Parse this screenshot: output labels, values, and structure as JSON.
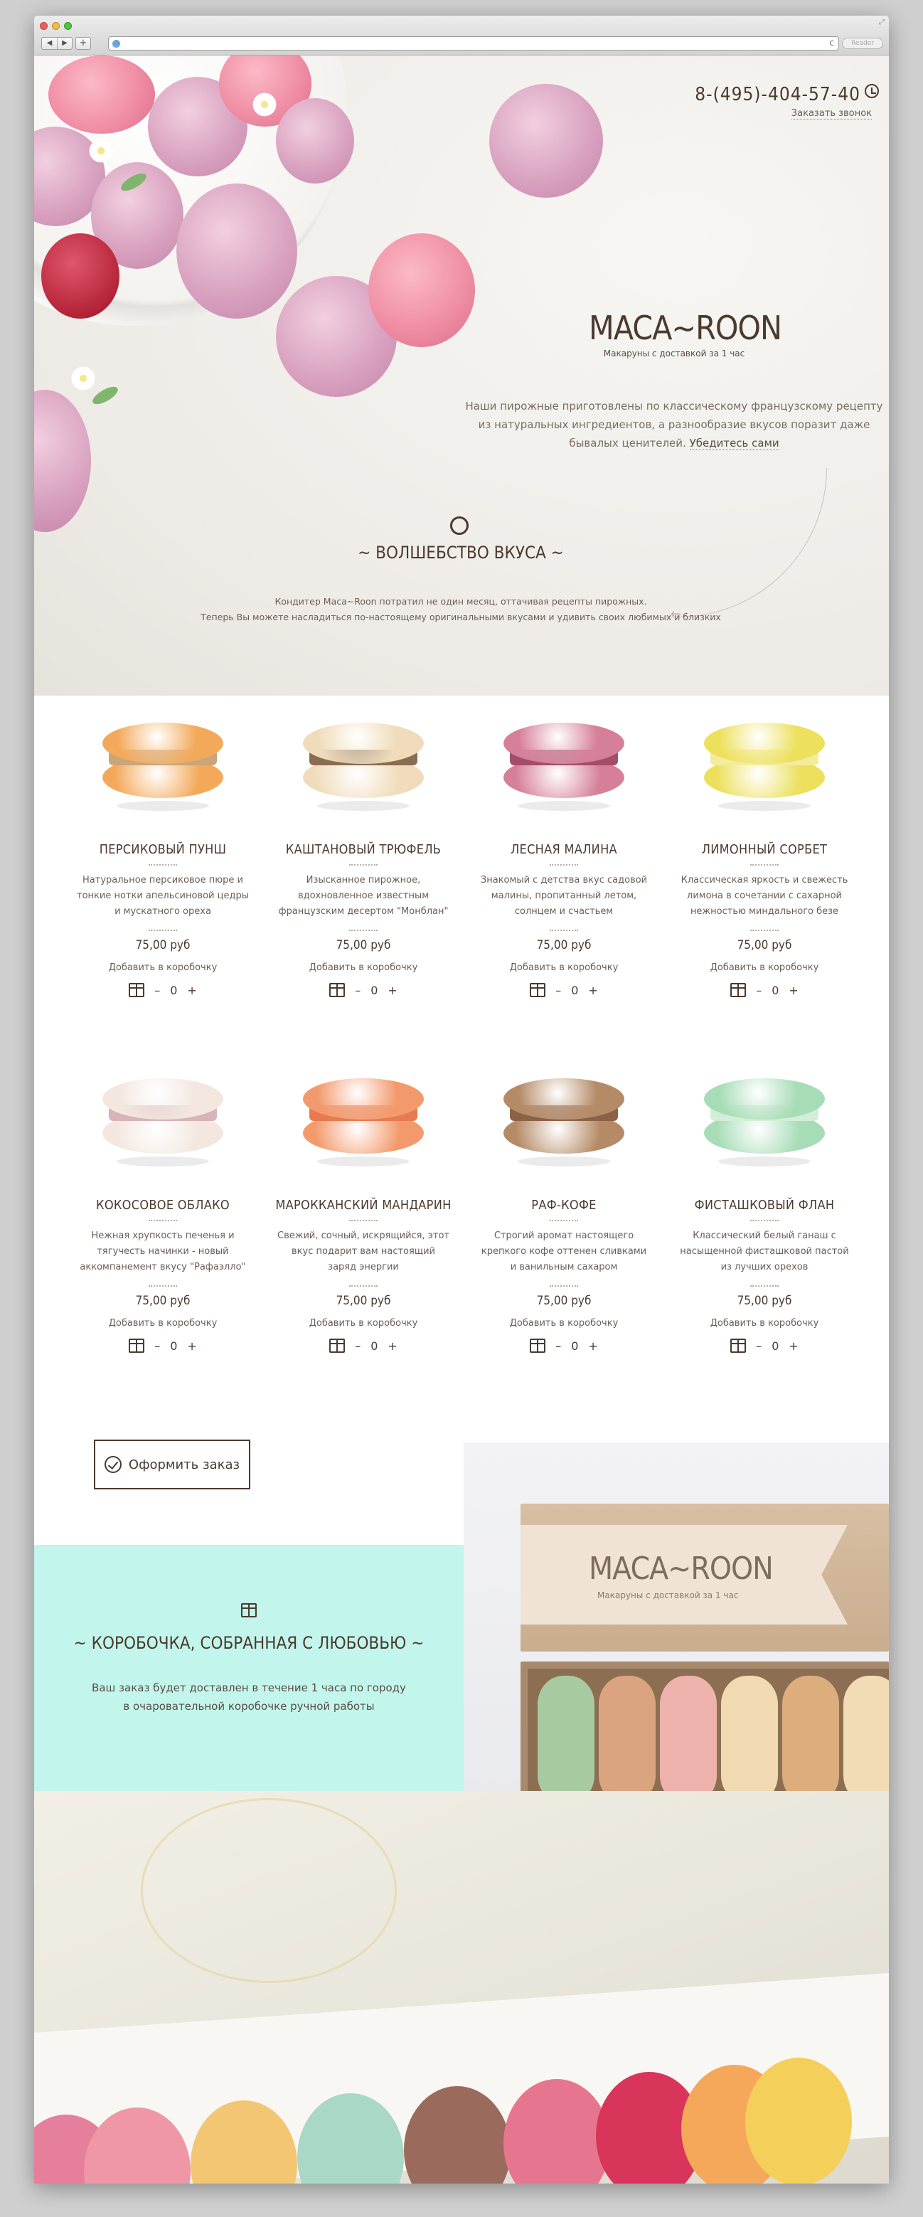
{
  "browser": {
    "back": "◀",
    "forward": "▶",
    "new_tab": "+",
    "reader": "Reader",
    "reload": "c"
  },
  "header": {
    "phone": "8-(495)-404-57-40",
    "callback": "Заказать звонок"
  },
  "brand": {
    "logo": "MACA~ROON",
    "tagline": "Макаруны с доставкой за 1 час"
  },
  "intro": {
    "text": "Наши пирожные приготовлены по классическому французскому рецепту из натуральных ингредиентов, а разнообразие вкусов поразит даже бывалых ценителей.",
    "link": "Убедитесь сами"
  },
  "section": {
    "title": "~ ВОЛШЕБСТВО ВКУСА ~",
    "line1": "Кондитер Maca~Roon потратил не один месяц, оттачивая рецепты пирожных.",
    "line2": "Теперь Вы можете насладиться по-настоящему оригинальными вкусами и удивить своих любимых и близких"
  },
  "products": [
    {
      "name": "ПЕРСИКОВЫЙ ПУНШ",
      "desc": "Натуральное персиковое пюре и тонкие нотки апельсиновой цедры и мускатного ореха",
      "price": "75,00 руб",
      "add": "Добавить в коробочку",
      "minus": "–",
      "qty": "0",
      "plus": "+",
      "color": "#f3a95a",
      "filling": "#c9a57a"
    },
    {
      "name": "КАШТАНОВЫЙ ТРЮФЕЛЬ",
      "desc": "Изысканное пирожное, вдохновленное известным французским десертом \"Монблан\"",
      "price": "75,00 руб",
      "add": "Добавить в коробочку",
      "minus": "–",
      "qty": "0",
      "plus": "+",
      "color": "#f0dcba",
      "filling": "#8a6c52"
    },
    {
      "name": "ЛЕСНАЯ МАЛИНА",
      "desc": "Знакомый с детства вкус садовой малины, пропитанный летом, солнцем и счастьем",
      "price": "75,00 руб",
      "add": "Добавить в коробочку",
      "minus": "–",
      "qty": "0",
      "plus": "+",
      "color": "#d67f99",
      "filling": "#a44d6a"
    },
    {
      "name": "ЛИМОННЫЙ СОРБЕТ",
      "desc": "Классическая яркость и свежесть лимона в сочетании с сахарной нежностью миндального безе",
      "price": "75,00 руб",
      "add": "Добавить в коробочку",
      "minus": "–",
      "qty": "0",
      "plus": "+",
      "color": "#ece05c",
      "filling": "#f3ec9a"
    },
    {
      "name": "КОКОСОВОЕ ОБЛАКО",
      "desc": "Нежная хрупкость печенья и тягучесть начинки - новый аккомпанемент вкусу \"Рафаэлло\"",
      "price": "75,00 руб",
      "add": "Добавить в коробочку",
      "minus": "–",
      "qty": "0",
      "plus": "+",
      "color": "#f3e7df",
      "filling": "#d8b3b7"
    },
    {
      "name": "МАРОККАНСКИЙ МАНДАРИН",
      "desc": "Свежий, сочный, искрящийся, этот вкус подарит вам настоящий заряд энергии",
      "price": "75,00 руб",
      "add": "Добавить в коробочку",
      "minus": "–",
      "qty": "0",
      "plus": "+",
      "color": "#f39a6d",
      "filling": "#e87a4f"
    },
    {
      "name": "РАФ-КОФЕ",
      "desc": "Строгий аромат настоящего крепкого кофе оттенен сливками и ванильным сахаром",
      "price": "75,00 руб",
      "add": "Добавить в коробочку",
      "minus": "–",
      "qty": "0",
      "plus": "+",
      "color": "#b58a66",
      "filling": "#8b6246"
    },
    {
      "name": "ФИСТАШКОВЫЙ ФЛАН",
      "desc": "Классический белый ганаш с насыщенной фисташковой пастой из лучших орехов",
      "price": "75,00 руб",
      "add": "Добавить в коробочку",
      "minus": "–",
      "qty": "0",
      "plus": "+",
      "color": "#a6dcb6",
      "filling": "#d3eed6"
    }
  ],
  "order_button": "Оформить заказ",
  "box_section": {
    "title": "~ КОРОБОЧКА, СОБРАННАЯ С ЛЮБОВЬЮ ~",
    "line1": "Ваш заказ будет доставлен в течение 1 часа по городу",
    "line2": "в очаровательной коробочке ручной работы",
    "box_logo": "MACA~ROON",
    "box_tagline": "Макаруны с доставкой за 1 час"
  },
  "colors": {
    "brown": "#4b3a2f",
    "mint": "#c2f6ec"
  }
}
